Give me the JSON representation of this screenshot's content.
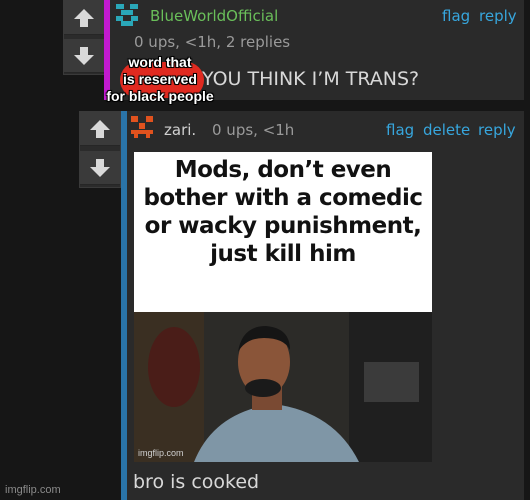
{
  "comment1": {
    "username": "BlueWorldOfficial",
    "meta": "0 ups, <1h, 2 replies",
    "actions": [
      "flag",
      "reply"
    ],
    "text": "YOU THINK I’M TRANS?"
  },
  "overlay_text": "word that\nis reserved\nfor black people",
  "comment2": {
    "username": "zari.",
    "meta": "0 ups, <1h",
    "actions": [
      "flag",
      "delete",
      "reply"
    ],
    "image_caption": "Mods, don’t even\nbother with a comedic\nor wacky punishment,\njust kill him",
    "image_watermark": "imgflip.com",
    "text": "bro is cooked"
  },
  "page_watermark": "imgflip.com",
  "colors": {
    "username": "#6abf5a",
    "link": "#37a6dd",
    "reply_bar_1": "#c21ad0",
    "reply_bar_2": "#2a74a8",
    "avatar_1": "#2aa7b8",
    "avatar_2": "#e0521e"
  },
  "icons": [
    "upvote-arrow-icon",
    "downvote-arrow-icon",
    "avatar-identicon"
  ]
}
